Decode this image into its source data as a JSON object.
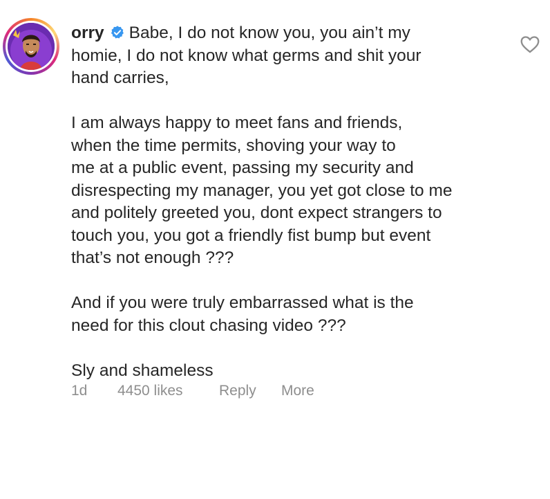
{
  "comment": {
    "username": "orry",
    "first_line": "Babe, I do not know you, you ain’t my",
    "para1_lines": [
      "homie, I do not know what germs and shit your",
      "hand carries,"
    ],
    "para2_lines": [
      "I am always happy to meet fans and friends,",
      "when the time permits, shoving your way to",
      "me at a public event, passing my security and",
      "disrespecting my manager, you yet got close to me",
      "and politely greeted you, dont expect strangers to",
      "touch you, you got a friendly fist bump but event",
      "that’s not enough ???"
    ],
    "para3_lines": [
      "And if you were truly embarrassed what is the",
      "need for this clout chasing video ???"
    ],
    "para4_lines": [
      "Sly and shameless"
    ],
    "meta": {
      "age": "1d",
      "likes": "4450 likes",
      "reply_label": "Reply",
      "more_label": "More"
    },
    "icons": {
      "verified": "verified-badge-icon",
      "like": "heart-icon"
    }
  },
  "colors": {
    "text": "#262626",
    "meta": "#8e8e8e",
    "verified": "#3897f0"
  }
}
